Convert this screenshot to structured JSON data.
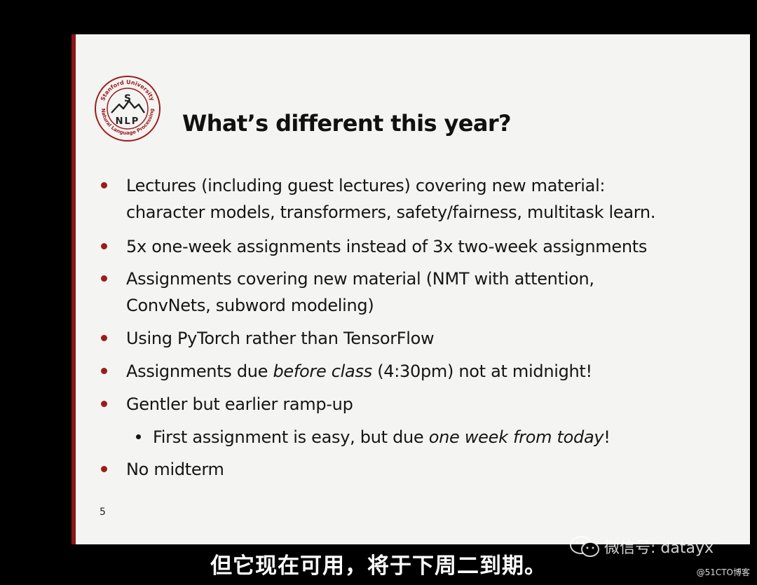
{
  "slide": {
    "logo": {
      "ring_top": "Stanford University",
      "ring_bottom": "Natural Language Processing",
      "letter_top": "S",
      "letters_bottom": "NLP"
    },
    "title": "What’s different this year?",
    "bullets": [
      {
        "lines": [
          "Lectures (including guest lectures) covering new material:",
          "character models, transformers, safety/fairness, multitask learn."
        ]
      },
      {
        "lines": [
          "5x one-week assignments instead of 3x two-week assignments"
        ]
      },
      {
        "lines": [
          "Assignments covering new material (NMT with attention,",
          "ConvNets, subword modeling)"
        ]
      },
      {
        "lines": [
          "Using PyTorch rather than TensorFlow"
        ]
      },
      {
        "pre": "Assignments due ",
        "em": "before class",
        "post": " (4:30pm) not at midnight!"
      },
      {
        "lines": [
          "Gentler but earlier ramp-up"
        ]
      },
      {
        "lines": [
          "No midterm"
        ]
      }
    ],
    "sub_bullet": {
      "pre": "First assignment is easy, but due ",
      "em": "one week from today",
      "post": "!"
    },
    "page_number": "5"
  },
  "subtitle": "但它现在可用，将于下周二到期。",
  "watermark": {
    "text": "微信号: datayx"
  },
  "site_tag": "@51CTO博客",
  "colors": {
    "accent": "#8c1515",
    "slide_bg": "#f4f4f2",
    "background": "#000000"
  }
}
